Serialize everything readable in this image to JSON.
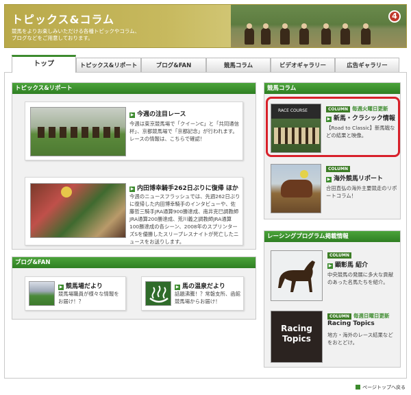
{
  "header": {
    "title": "トピックス&コラム",
    "description": "競馬をよりお楽しみいただける各種トピックやコラム、ブログなどをご用意しております。",
    "badge": "4"
  },
  "tabs": [
    {
      "label": "トップ",
      "active": true
    },
    {
      "label": "トピックス&リポート",
      "active": false
    },
    {
      "label": "ブログ&FAN",
      "active": false
    },
    {
      "label": "競馬コラム",
      "active": false
    },
    {
      "label": "ビデオギャラリー",
      "active": false
    },
    {
      "label": "広告ギャラリー",
      "active": false
    }
  ],
  "topics": {
    "heading": "トピックス&リポート",
    "items": [
      {
        "title": "今週の注目レース",
        "text": "今週は東京競馬場で「クイーンC」と「共同通信杯」、京都競馬場で「京都記念」が行われます。レースの情報は、こちらで確認！"
      },
      {
        "title": "内田博幸騎手262日ぶりに復帰 ほか",
        "text": "今週のニュースフラッシュでは、先週262日ぶりに復帰した内田博幸騎手のインタビューや、佐藤哲三騎手JRA通算900勝達成、南井克巳調教師JRA通算200勝達成、荒川義之調教師JRA通算100勝達成の各シーン、2008年のスプリンターズSを優勝したスリープレスナイトが死亡したニュースをお送りします。"
      }
    ]
  },
  "blog": {
    "heading": "ブログ&FAN",
    "items": [
      {
        "title": "競馬場だより",
        "text": "競馬場職員が様々な情報をお届け！？"
      },
      {
        "title": "馬の温泉だより",
        "text": "話題沸騰！？常磐支所、函館競馬場からお届け！"
      }
    ]
  },
  "column": {
    "heading": "競馬コラム",
    "items": [
      {
        "tag": "COLUMN",
        "note": "毎週火曜日更新",
        "title": "新馬・クラシック情報",
        "text": "【Road to Classic】新馬戦などの結果と映像。",
        "photo_text": "RACE COURSE"
      },
      {
        "tag": "COLUMN",
        "note": "",
        "title": "海外競馬リポート",
        "text": "合田直弘の海外主要競走のリポートコラム！"
      }
    ]
  },
  "racing": {
    "heading": "レーシングプログラム掲載情報",
    "items": [
      {
        "tag": "COLUMN",
        "note": "",
        "title": "顕彰馬 紹介",
        "text": "中央競馬の発展に多大な貢献のあった名馬たちを紹介。"
      },
      {
        "tag": "COLUMN",
        "note": "毎週日曜日更新",
        "title": "Racing Topics",
        "text": "地方・海外のレース結果などをおとどけ。",
        "logo_line1": "Racing",
        "logo_line2": "Topics"
      }
    ]
  },
  "footer": {
    "page_top": "ページトップへ戻る"
  },
  "colors": {
    "accent": "#3d8b2e",
    "highlight": "#d8202a"
  }
}
